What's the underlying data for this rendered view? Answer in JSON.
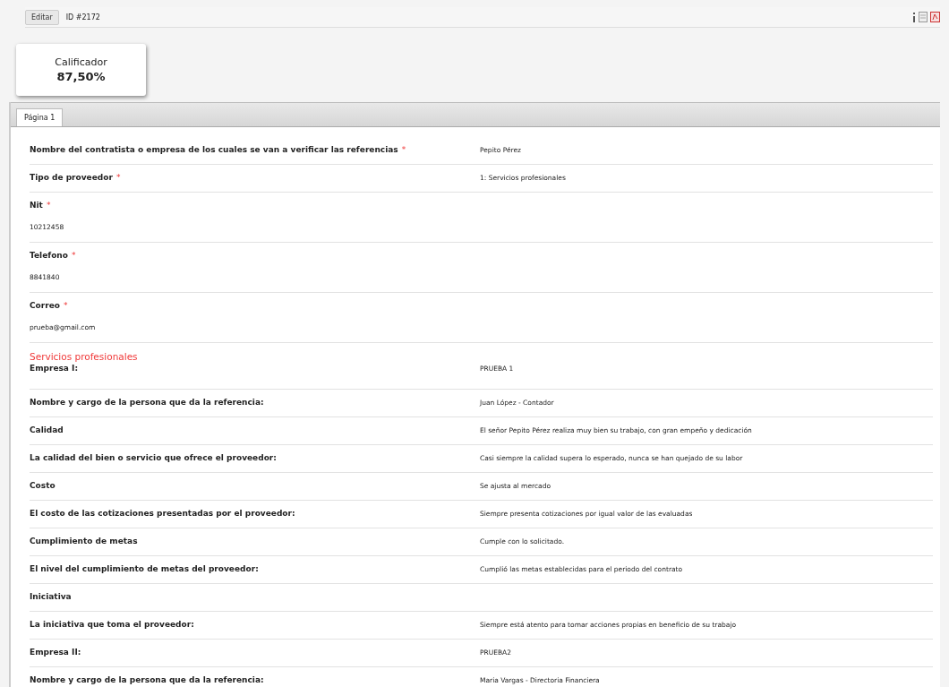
{
  "toolbar": {
    "edit_button": "Editar",
    "record_id": "ID #2172"
  },
  "score_card": {
    "title": "Calificador",
    "value": "87,50%"
  },
  "tabs": [
    {
      "label": "Página 1",
      "selected": true
    }
  ],
  "fields": [
    {
      "kind": "inline",
      "label": "Nombre del contratista o empresa de los cuales se van a verificar las referencias",
      "required_mark": "*",
      "value": "Pepito Pérez"
    },
    {
      "kind": "inline",
      "label": "Tipo de proveedor",
      "required_mark": "*",
      "value": "1: Servicios profesionales"
    },
    {
      "kind": "stacked",
      "label": "Nit",
      "required_mark": "*",
      "value": "10212458"
    },
    {
      "kind": "stacked",
      "label": "Telefono",
      "required_mark": "*",
      "value": "8841840"
    },
    {
      "kind": "stacked",
      "label": "Correo",
      "required_mark": "*",
      "value": "prueba@gmail.com"
    },
    {
      "kind": "section",
      "label": "Servicios profesionales"
    },
    {
      "kind": "inline",
      "label": "Empresa I:",
      "value": "PRUEBA 1"
    },
    {
      "kind": "inline",
      "label": "Nombre y cargo de la persona que da la referencia:",
      "value": "Juan López - Contador"
    },
    {
      "kind": "inline",
      "label": "Calidad",
      "value": "El señor Pepito Pérez realiza muy bien su trabajo, con gran empeño y dedicación"
    },
    {
      "kind": "inline",
      "label": "La calidad del bien o servicio que ofrece el proveedor:",
      "value": "Casi siempre la calidad supera lo esperado, nunca se han quejado de su labor"
    },
    {
      "kind": "inline",
      "label": "Costo",
      "value": "Se ajusta al mercado"
    },
    {
      "kind": "inline",
      "label": "El costo de las cotizaciones presentadas por el proveedor:",
      "value": "Siempre presenta cotizaciones por igual valor de las evaluadas"
    },
    {
      "kind": "inline",
      "label": "Cumplimiento de metas",
      "value": "Cumple con lo solicitado."
    },
    {
      "kind": "inline",
      "label": "El nivel del cumplimiento de metas del proveedor:",
      "value": "Cumplió las metas establecidas para el periodo del contrato"
    },
    {
      "kind": "inline",
      "label": "Iniciativa"
    },
    {
      "kind": "inline",
      "label": "La iniciativa que toma el proveedor:",
      "value": "Siempre está atento para tomar acciones propias en beneficio de su trabajo"
    },
    {
      "kind": "inline",
      "label": "Empresa II:",
      "value": "PRUEBA2"
    },
    {
      "kind": "inline",
      "label": "Nombre y cargo de la persona que da la referencia:",
      "value": "Maria Vargas - Directoria Financiera"
    }
  ]
}
